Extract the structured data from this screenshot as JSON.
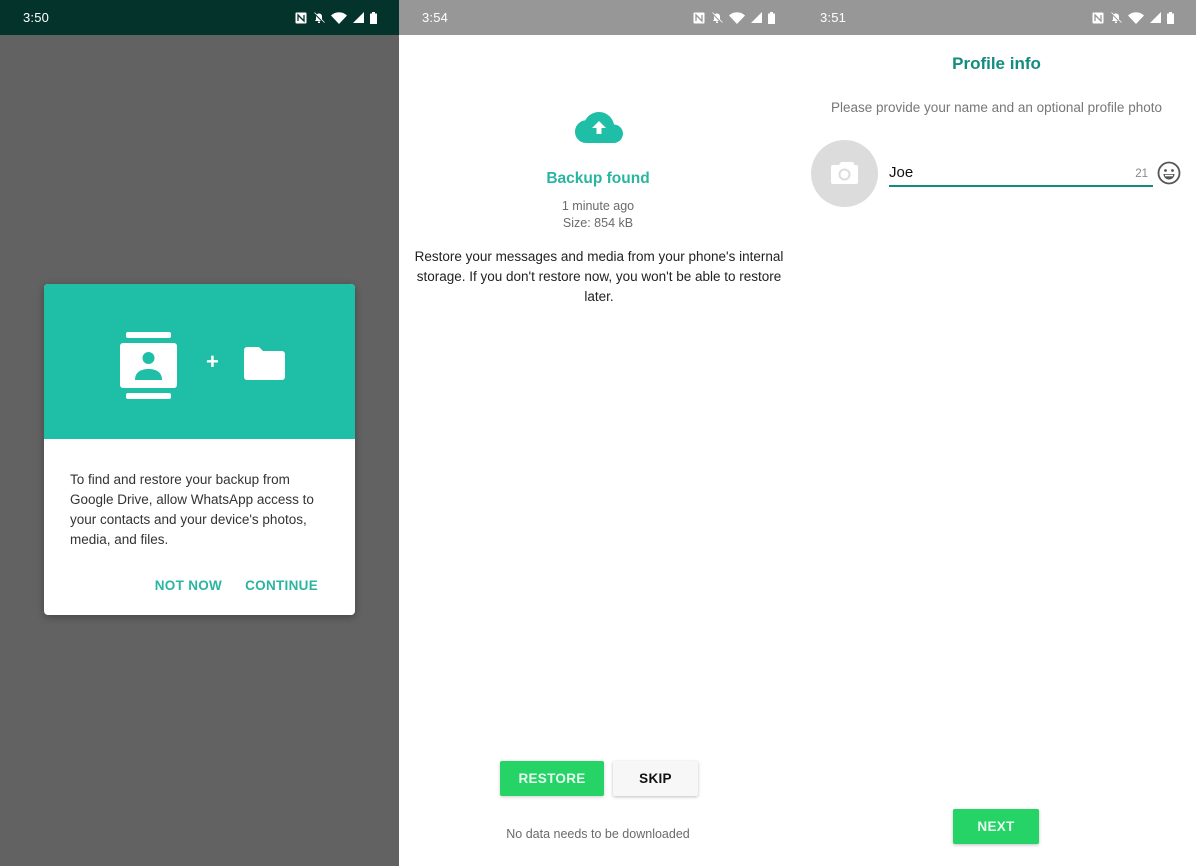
{
  "colors": {
    "teal_header": "#1fbea6",
    "teal_text": "#2ab5a0",
    "dark_teal": "#128c7e",
    "green_button": "#25d366",
    "status_dark": "#04332c",
    "status_gray": "#979797",
    "scrim": "#626262"
  },
  "screens": [
    {
      "status_bar": {
        "time": "3:50",
        "icons": [
          "nfc-icon",
          "bell-off-icon",
          "wifi-icon",
          "cell-signal-icon",
          "battery-icon"
        ]
      },
      "dialog": {
        "header_icons": [
          "contacts-icon",
          "plus-icon",
          "folder-icon"
        ],
        "plus_symbol": "+",
        "message": "To find and restore your backup from Google Drive, allow WhatsApp access to your contacts and your device's photos, media, and files.",
        "not_now_label": "NOT NOW",
        "continue_label": "CONTINUE"
      }
    },
    {
      "status_bar": {
        "time": "3:54",
        "icons": [
          "nfc-icon",
          "bell-off-icon",
          "wifi-icon",
          "cell-signal-icon",
          "battery-icon"
        ]
      },
      "backup": {
        "icon": "cloud-upload-icon",
        "title": "Backup found",
        "time_ago": "1 minute ago",
        "size": "Size: 854 kB",
        "description": "Restore your messages and media from your phone's internal storage. If you don't restore now, you won't be able to restore later.",
        "restore_label": "RESTORE",
        "skip_label": "SKIP",
        "footer_note": "No data needs to be downloaded"
      }
    },
    {
      "status_bar": {
        "time": "3:51",
        "icons": [
          "nfc-icon",
          "bell-off-icon",
          "wifi-icon",
          "cell-signal-icon",
          "battery-icon"
        ]
      },
      "profile": {
        "title": "Profile info",
        "subtitle": "Please provide your name and an optional profile photo",
        "name_value": "Joe",
        "chars_remaining": "21",
        "next_label": "NEXT"
      }
    }
  ]
}
